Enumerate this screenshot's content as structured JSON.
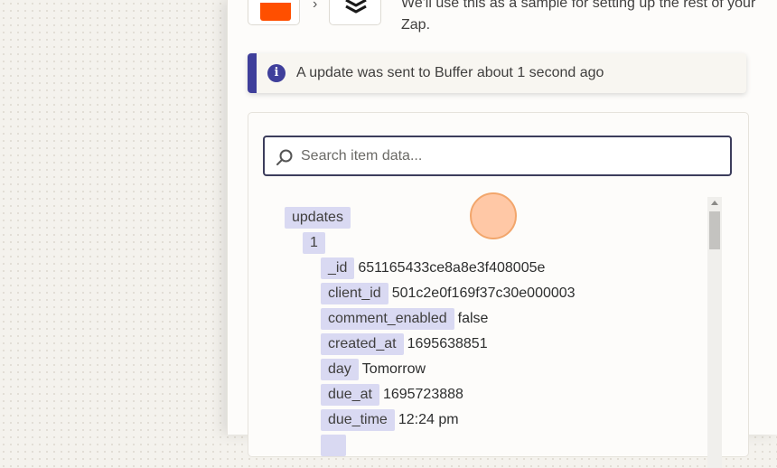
{
  "header": {
    "intro_text": "We'll use this as a sample for setting up the rest of your Zap.",
    "trigger_icon": "orange-square-app-icon",
    "action_icon": "buffer-layers-icon",
    "arrow_icon": "chevron-right-icon"
  },
  "info": {
    "icon": "info-icon",
    "message": "A update was sent to Buffer about 1 second ago"
  },
  "search": {
    "placeholder": "Search item data...",
    "value": ""
  },
  "tree": {
    "root_key": "updates",
    "index_key": "1",
    "fields": [
      {
        "key": "_id",
        "value": "651165433ce8a8e3f408005e"
      },
      {
        "key": "client_id",
        "value": "501c2e0f169f37c30e000003"
      },
      {
        "key": "comment_enabled",
        "value": "false"
      },
      {
        "key": "created_at",
        "value": "1695638851"
      },
      {
        "key": "day",
        "value": "Tomorrow"
      },
      {
        "key": "due_at",
        "value": "1695723888"
      },
      {
        "key": "due_time",
        "value": "12:24 pm"
      }
    ]
  },
  "colors": {
    "accent": "#3f3f9b",
    "key_bg": "#d9d9f2",
    "zapier_orange": "#ff4f00"
  }
}
